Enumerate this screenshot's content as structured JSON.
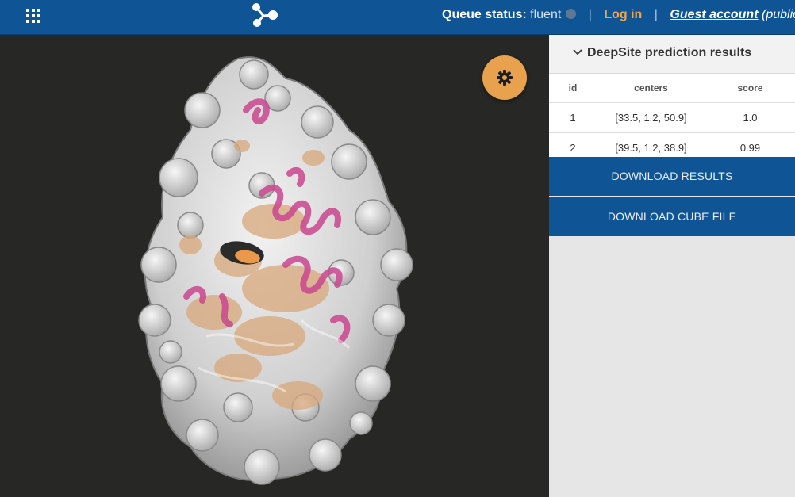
{
  "header": {
    "queue_label": "Queue status",
    "queue_value": "fluent",
    "login_label": "Log in",
    "guest_label": "Guest account",
    "guest_note": "(public data"
  },
  "icons": {
    "apps": "apps-grid-icon",
    "logo": "molecule-logo-icon",
    "settings": "gear-icon",
    "collapse": "chevron-down-icon"
  },
  "colors": {
    "brand_blue": "#0f5596",
    "accent_orange": "#e8a24e",
    "viewer_background": "#272726"
  },
  "panel": {
    "title": "DeepSite prediction results",
    "columns": [
      "id",
      "centers",
      "score"
    ],
    "rows": [
      {
        "id": "1",
        "centers": "[33.5, 1.2, 50.9]",
        "score": "1.0"
      },
      {
        "id": "2",
        "centers": "[39.5, 1.2, 38.9]",
        "score": "0.99"
      }
    ],
    "download_results": "DOWNLOAD RESULTS",
    "download_cube": "DOWNLOAD CUBE FILE"
  }
}
